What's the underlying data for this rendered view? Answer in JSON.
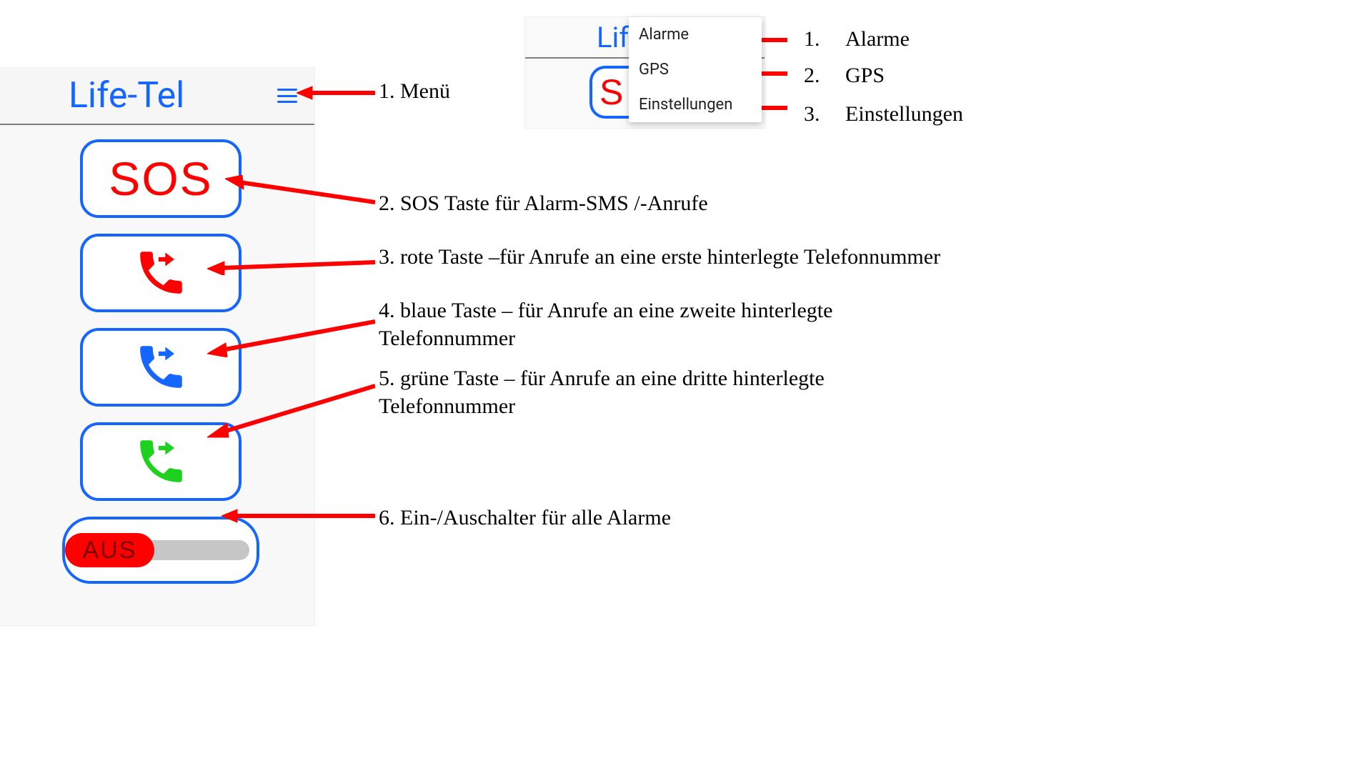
{
  "phone": {
    "title": "Life-Tel",
    "sos_label": "SOS",
    "toggle_off_label": "AUS"
  },
  "menu": {
    "title_fragment": "Lif",
    "sos_fragment": "S",
    "items": [
      "Alarme",
      "GPS",
      "Einstellungen"
    ]
  },
  "annotations": {
    "a1": "1. Menü",
    "a2": "2. SOS  Taste für Alarm-SMS /-Anrufe",
    "a3": "3. rote Taste –für Anrufe an eine erste hinterlegte Telefonnummer",
    "a4": "4. blaue Taste – für Anrufe an eine zweite hinterlegte Telefonnummer",
    "a5": "5. grüne Taste  – für Anrufe an eine dritte hinterlegte Telefonnummer",
    "a6": "6. Ein-/Auschalter für alle Alarme",
    "right_list": {
      "n1": "1.",
      "l1": "Alarme",
      "n2": "2.",
      "l2": "GPS",
      "n3": "3.",
      "l3": "Einstellungen"
    }
  }
}
